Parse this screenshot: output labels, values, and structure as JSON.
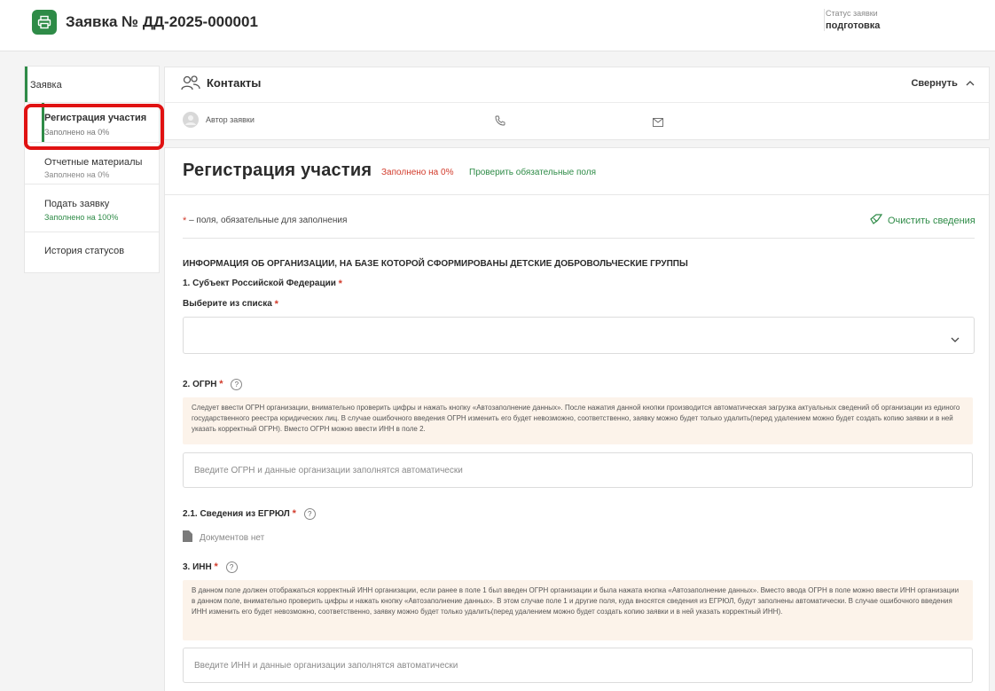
{
  "header": {
    "title": "Заявка № ДД-2025-000001",
    "status_caption": "Статус заявки",
    "status_value": "подготовка",
    "icon": "printer-icon"
  },
  "sidebar": {
    "group_label": "Заявка",
    "items": [
      {
        "label": "Регистрация участия",
        "sub": "Заполнено на 0%"
      },
      {
        "label": "Отчетные материалы",
        "sub": "Заполнено на 0%"
      },
      {
        "label": "Подать заявку",
        "sub": "Заполнено на 100%"
      },
      {
        "label": "История статусов",
        "sub": ""
      }
    ]
  },
  "contacts": {
    "title": "Контакты",
    "collapse": "Свернуть",
    "author_label": "Автор заявки",
    "icons": [
      "users-icon",
      "phone-icon",
      "mail-icon",
      "chevron-up-icon"
    ]
  },
  "form": {
    "title": "Регистрация участия",
    "fill_status": "Заполнено на 0%",
    "check_required": "Проверить обязательные поля",
    "required_note": "– поля, обязательные для заполнения",
    "clear_button": "Очистить сведения",
    "section_heading": "ИНФОРМАЦИЯ ОБ ОРГАНИЗАЦИИ, НА БАЗЕ КОТОРОЙ СФОРМИРОВАНЫ ДЕТСКИЕ ДОБРОВОЛЬЧЕСКИЕ ГРУППЫ",
    "field1_label": "1. Субъект Российской Федерации",
    "field1_sub": "Выберите из списка",
    "field2_label": "2. ОГРН",
    "field2_hint": "Следует ввести ОГРН организации, внимательно проверить цифры и нажать кнопку «Автозаполнение данных». После нажатия данной кнопки производится автоматическая загрузка актуальных сведений об организации из единого государственного реестра юридических лиц. В случае ошибочного введения ОГРН изменить его будет невозможно, соответственно, заявку можно будет только удалить(перед удалением можно будет создать копию заявки и в ней указать корректный ОГРН). Вместо ОГРН можно ввести ИНН в поле 2.",
    "field2_placeholder": "Введите ОГРН и данные организации заполнятся автоматически",
    "field21_label": "2.1. Сведения из ЕГРЮЛ",
    "field21_docs": "Документов нет",
    "field3_label": "3. ИНН",
    "field3_hint": "В данном поле должен отображаться корректный ИНН организации, если ранее в поле 1 был введен ОГРН организации и была нажата кнопка «Автозаполнение данных». Вместо ввода ОГРН в поле можно ввести ИНН организации в данном поле, внимательно проверить цифры и нажать кнопку «Автозаполнение данных». В этом случае поле 1 и другие поля, куда вносятся сведения из ЕГРЮЛ, будут заполнены автоматически. В случае ошибочного введения ИНН изменить его будет невозможно, соответственно, заявку можно будет только удалить(перед удалением можно будет создать копию заявки и в ней указать корректный ИНН).",
    "field3_placeholder": "Введите ИНН и данные организации заполнятся автоматически"
  },
  "colors": {
    "accent": "#2e8b47",
    "required": "#d23b2b",
    "highlight": "#e01212",
    "hint_bg": "#fcf3ea"
  }
}
